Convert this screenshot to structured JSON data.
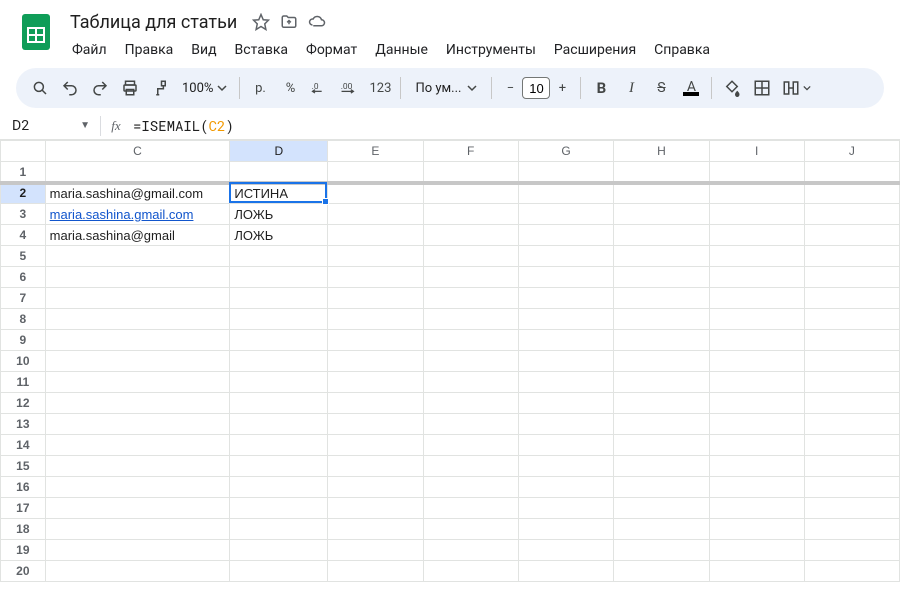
{
  "doc": {
    "title": "Таблица для статьи"
  },
  "menu": {
    "file": "Файл",
    "edit": "Правка",
    "view": "Вид",
    "insert": "Вставка",
    "format": "Формат",
    "data": "Данные",
    "tools": "Инструменты",
    "extensions": "Расширения",
    "help": "Справка"
  },
  "toolbar": {
    "zoom": "100%",
    "currency": "р.",
    "percent": "%",
    "dec_dec": ".0",
    "inc_dec": ".00",
    "numfmt": "123",
    "font_name": "По ум...",
    "font_size": "10"
  },
  "namebox": {
    "cell": "D2"
  },
  "formula": {
    "prefix": "=ISEMAIL(",
    "ref": "C2",
    "suffix": ")"
  },
  "columns": [
    "C",
    "D",
    "E",
    "F",
    "G",
    "H",
    "I",
    "J"
  ],
  "rows": [
    "1",
    "2",
    "3",
    "4",
    "5",
    "6",
    "7",
    "8",
    "9",
    "10",
    "11",
    "12",
    "13",
    "14",
    "15",
    "16",
    "17",
    "18",
    "19",
    "20"
  ],
  "cells": {
    "C2": "maria.sashina@gmail.com",
    "D2": "ИСТИНА",
    "C3": "maria.sashina.gmail.com",
    "D3": "ЛОЖЬ",
    "C4": "maria.sashina@gmail",
    "D4": "ЛОЖЬ"
  },
  "selection": {
    "col": "D",
    "row": "2"
  }
}
